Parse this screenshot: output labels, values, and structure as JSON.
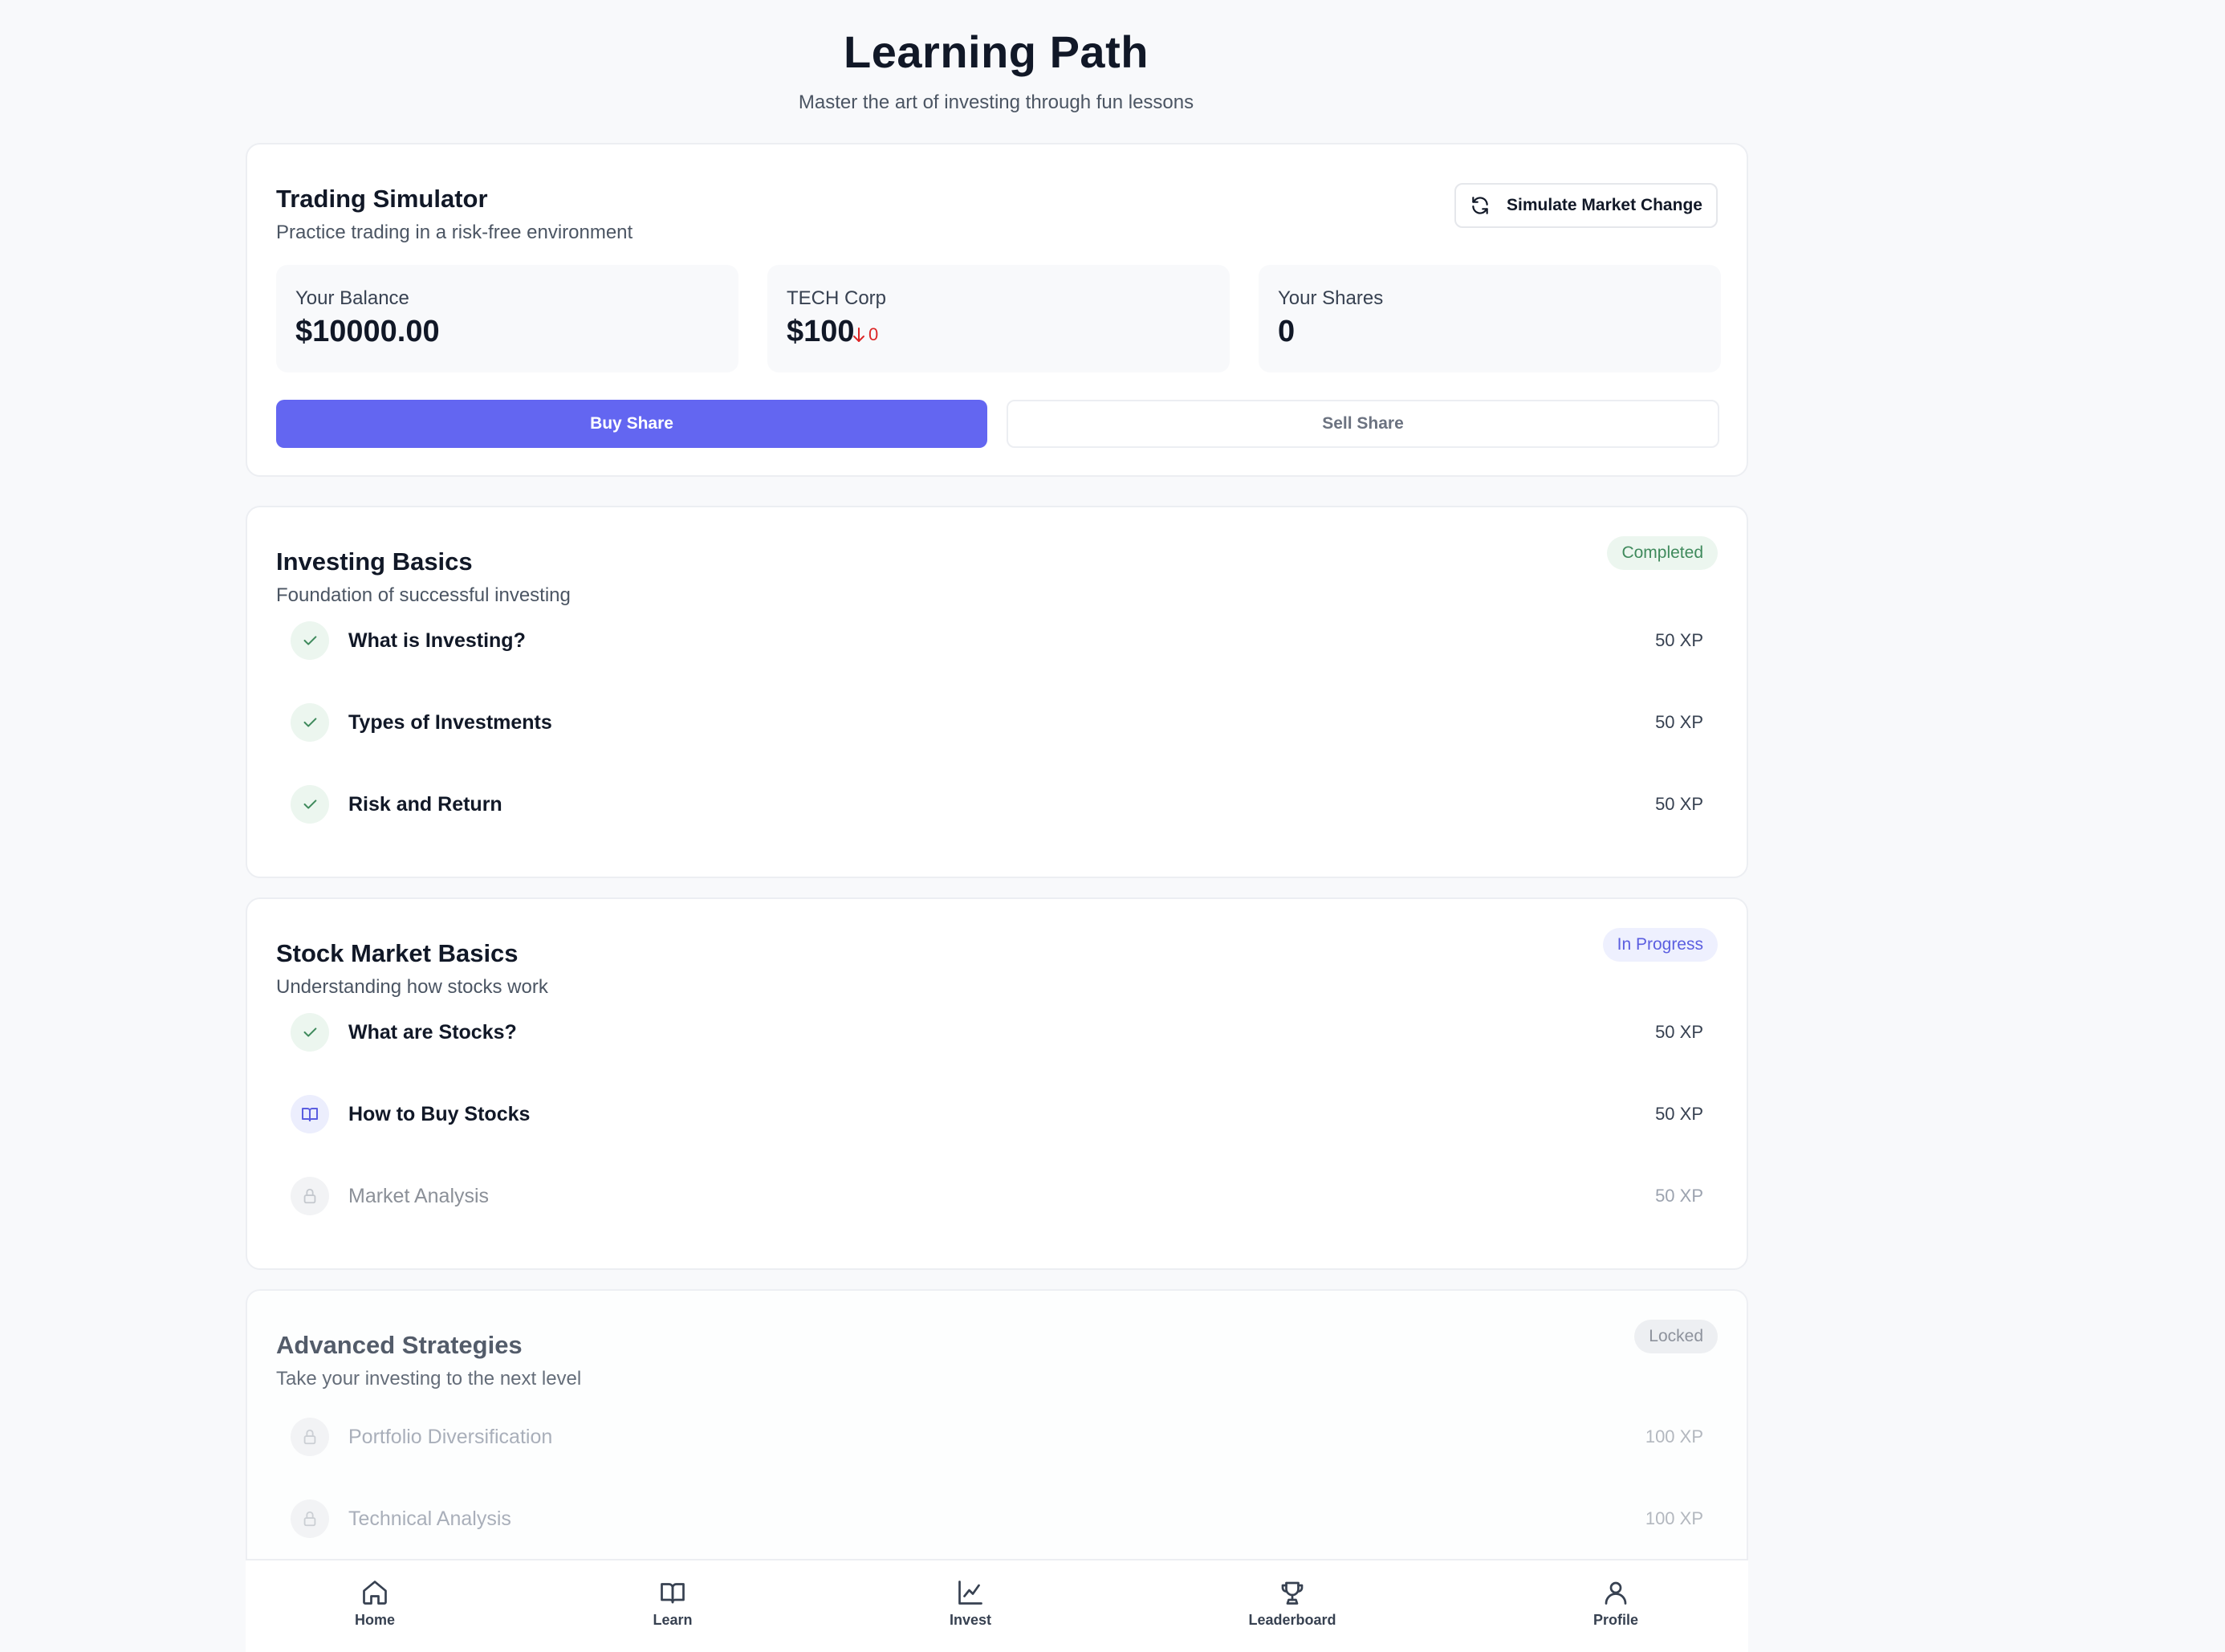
{
  "header": {
    "title": "Learning Path",
    "subtitle": "Master the art of investing through fun lessons"
  },
  "simulator": {
    "title": "Trading Simulator",
    "subtitle": "Practice trading in a risk-free environment",
    "simulate_label": "Simulate Market Change",
    "balance_label": "Your Balance",
    "balance_value": "$10000.00",
    "stock_label": "TECH Corp",
    "stock_price": "$100",
    "stock_change": "0",
    "stock_change_color": "#dc2626",
    "shares_label": "Your Shares",
    "shares_value": "0",
    "buy_label": "Buy Share",
    "sell_label": "Sell Share",
    "accent": "#6366f1"
  },
  "modules": [
    {
      "title": "Investing Basics",
      "subtitle": "Foundation of successful investing",
      "status": "Completed",
      "lessons": [
        {
          "name": "What is Investing?",
          "xp": "50 XP",
          "state": "done"
        },
        {
          "name": "Types of Investments",
          "xp": "50 XP",
          "state": "done"
        },
        {
          "name": "Risk and Return",
          "xp": "50 XP",
          "state": "done"
        }
      ]
    },
    {
      "title": "Stock Market Basics",
      "subtitle": "Understanding how stocks work",
      "status": "In Progress",
      "lessons": [
        {
          "name": "What are Stocks?",
          "xp": "50 XP",
          "state": "done"
        },
        {
          "name": "How to Buy Stocks",
          "xp": "50 XP",
          "state": "current"
        },
        {
          "name": "Market Analysis",
          "xp": "50 XP",
          "state": "locked"
        }
      ]
    },
    {
      "title": "Advanced Strategies",
      "subtitle": "Take your investing to the next level",
      "status": "Locked",
      "lessons": [
        {
          "name": "Portfolio Diversification",
          "xp": "100 XP",
          "state": "locked"
        },
        {
          "name": "Technical Analysis",
          "xp": "100 XP",
          "state": "locked"
        }
      ]
    }
  ],
  "nav": {
    "items": [
      {
        "label": "Home",
        "icon": "home-icon"
      },
      {
        "label": "Learn",
        "icon": "book-icon"
      },
      {
        "label": "Invest",
        "icon": "chart-icon"
      },
      {
        "label": "Leaderboard",
        "icon": "trophy-icon"
      },
      {
        "label": "Profile",
        "icon": "user-icon"
      }
    ]
  }
}
